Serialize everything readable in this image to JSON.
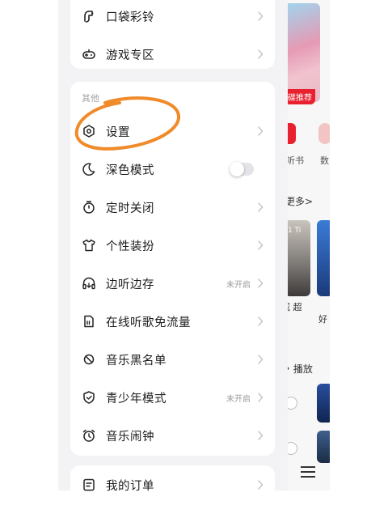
{
  "drawer": {
    "top_items": [
      {
        "label": "口袋彩铃",
        "icon": "ringtone-icon"
      },
      {
        "label": "游戏专区",
        "icon": "gamepad-icon"
      }
    ],
    "section_title": "其他",
    "items": [
      {
        "label": "设置",
        "icon": "gear-icon"
      },
      {
        "label": "深色模式",
        "icon": "moon-icon",
        "toggle": false
      },
      {
        "label": "定时关闭",
        "icon": "timer-icon"
      },
      {
        "label": "个性装扮",
        "icon": "tshirt-icon"
      },
      {
        "label": "边听边存",
        "icon": "headphones-icon",
        "state": "未开启"
      },
      {
        "label": "在线听歌免流量",
        "icon": "sim-card-icon"
      },
      {
        "label": "音乐黑名单",
        "icon": "blocked-icon"
      },
      {
        "label": "青少年模式",
        "icon": "shield-icon",
        "state": "未开启"
      },
      {
        "label": "音乐闹钟",
        "icon": "alarm-clock-icon"
      }
    ],
    "bottom_items": [
      {
        "label": "我的订单",
        "icon": "order-icon"
      }
    ]
  },
  "background": {
    "recommend_tag": "碟推荐",
    "shortcut_1": "听书",
    "shortcut_2": "数",
    "more_link": "更多>",
    "album_tag": "1 Ti",
    "song_a": "戚 超",
    "song_b": "好",
    "section_play": "• 播放"
  },
  "colors": {
    "annotation": "#f08a2a",
    "background_accent": "#e8212f"
  }
}
